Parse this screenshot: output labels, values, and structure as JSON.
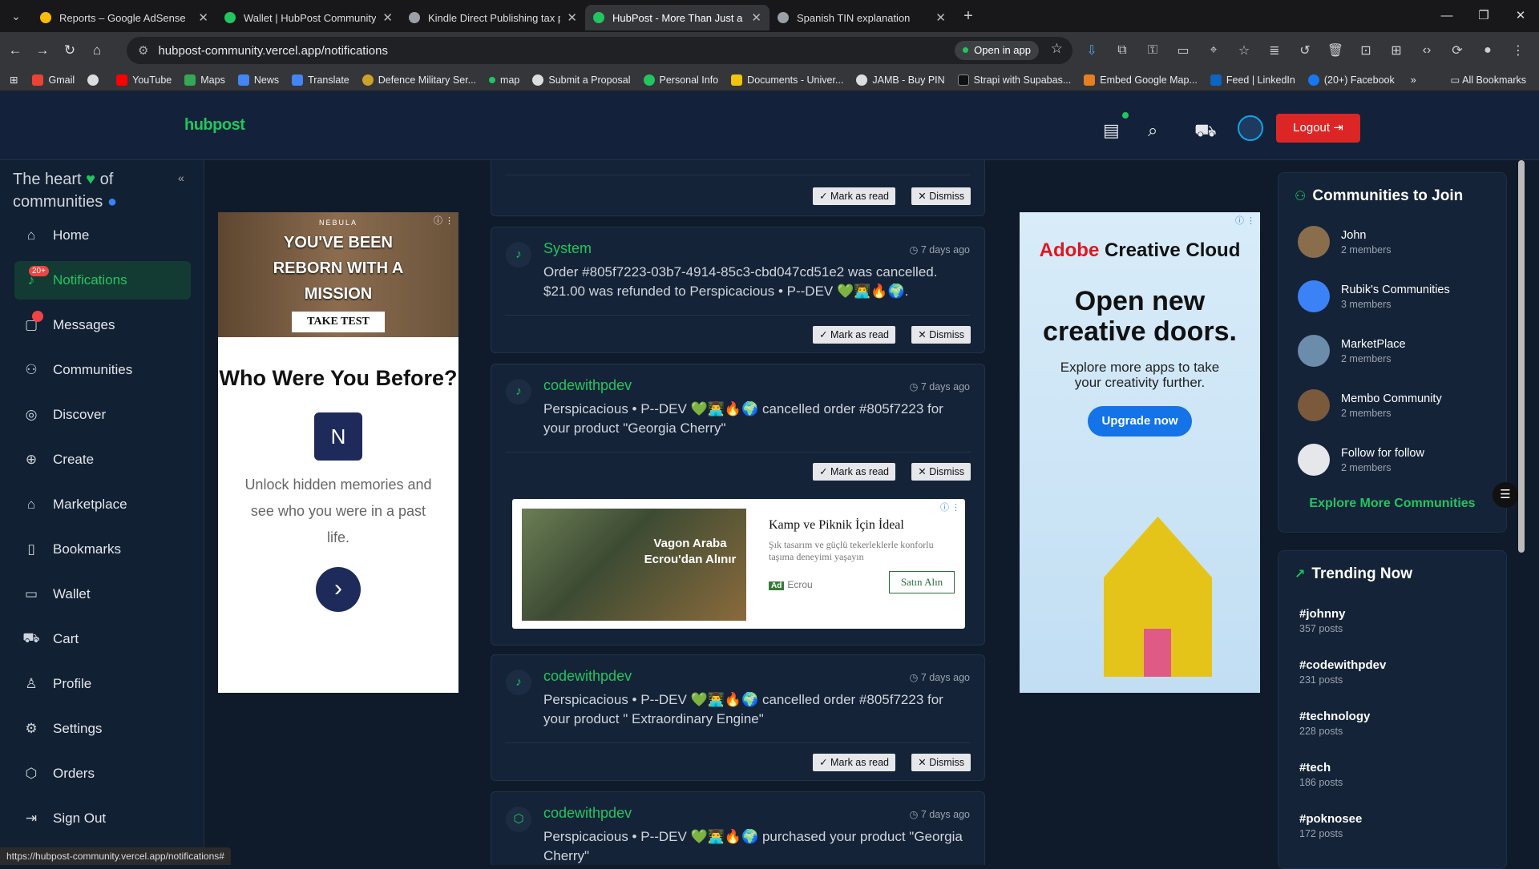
{
  "browser": {
    "tabs": [
      {
        "title": "Reports – Google AdSense",
        "color": "#fbbc04"
      },
      {
        "title": "Wallet | HubPost Community",
        "color": "#22c55e"
      },
      {
        "title": "Kindle Direct Publishing tax pro",
        "color": "#9aa0a6"
      },
      {
        "title": "HubPost - More Than Just a Co",
        "color": "#22c55e"
      },
      {
        "title": "Spanish TIN explanation",
        "color": "#9aa0a6"
      }
    ],
    "url": "hubpost-community.vercel.app/notifications",
    "open_in_app": "Open in app",
    "bookmarks": [
      "Gmail",
      "YouTube",
      "Maps",
      "News",
      "Translate",
      "Defence Military Ser...",
      "map",
      "Submit a Proposal",
      "Personal Info",
      "Documents - Univer...",
      "JAMB - Buy PIN",
      "Strapi with Supabas...",
      "Embed Google Map...",
      "Feed | LinkedIn",
      "(20+) Facebook"
    ],
    "all_bookmarks": "All Bookmarks",
    "status_url": "https://hubpost-community.vercel.app/notifications#"
  },
  "header": {
    "logo": "hubpost",
    "logout": "Logout"
  },
  "sidebar": {
    "tagline_1": "The heart",
    "tagline_2": "of",
    "tagline_3": "communities",
    "items": [
      {
        "label": "Home",
        "icon": "home-icon",
        "glyph": "⌂"
      },
      {
        "label": "Notifications",
        "icon": "bell-icon",
        "glyph": "♪",
        "badge": "20+"
      },
      {
        "label": "Messages",
        "icon": "message-icon",
        "glyph": "▢"
      },
      {
        "label": "Communities",
        "icon": "users-icon",
        "glyph": "⚇"
      },
      {
        "label": "Discover",
        "icon": "compass-icon",
        "glyph": "◎"
      },
      {
        "label": "Create",
        "icon": "plus-circle-icon",
        "glyph": "⊕"
      },
      {
        "label": "Marketplace",
        "icon": "store-icon",
        "glyph": "⌂"
      },
      {
        "label": "Bookmarks",
        "icon": "bookmark-icon",
        "glyph": "▯"
      },
      {
        "label": "Wallet",
        "icon": "wallet-icon",
        "glyph": "▭"
      },
      {
        "label": "Cart",
        "icon": "cart-icon",
        "glyph": "⛟"
      },
      {
        "label": "Profile",
        "icon": "user-icon",
        "glyph": "♙"
      },
      {
        "label": "Settings",
        "icon": "gear-icon",
        "glyph": "⚙"
      },
      {
        "label": "Orders",
        "icon": "package-icon",
        "glyph": "⬡"
      },
      {
        "label": "Sign Out",
        "icon": "sign-out-icon",
        "glyph": "⇥"
      }
    ]
  },
  "ad_left": {
    "brand": "NEBULA",
    "headline": "YOU'VE BEEN REBORN WITH A MISSION",
    "cta_top": "TAKE TEST",
    "title": "Who Were You Before?",
    "body": "Unlock hidden memories and see who you were in a past life."
  },
  "ad_right": {
    "brand_a": "Adobe",
    "brand_b": " Creative Cloud",
    "title": "Open new creative doors.",
    "body": "Explore more apps to take your creativity further.",
    "cta": "Upgrade now"
  },
  "feed": {
    "mark_read": "✓ Mark as read",
    "dismiss": "✕ Dismiss",
    "notifications": [
      {
        "who": "System",
        "time": "7 days ago",
        "msg": "Order #805f7223-03b7-4914-85c3-cbd047cd51e2 was cancelled. $21.00 was refunded to Perspicacious • P--DEV 💚👨‍💻🔥🌍."
      },
      {
        "who": "codewithpdev",
        "time": "7 days ago",
        "msg": "Perspicacious • P--DEV 💚👨‍💻🔥🌍 cancelled order #805f7223 for your product \"Georgia Cherry\""
      },
      {
        "who": "codewithpdev",
        "time": "7 days ago",
        "msg": "Perspicacious • P--DEV 💚👨‍💻🔥🌍 cancelled order #805f7223 for your product \" Extraordinary Engine\""
      },
      {
        "who": "codewithpdev",
        "time": "7 days ago",
        "msg": "Perspicacious • P--DEV 💚👨‍💻🔥🌍 purchased your product \"Georgia Cherry\""
      }
    ],
    "inline_ad": {
      "image_text": "Vagon Araba Ecrou'dan Alınır",
      "title": "Kamp ve Piknik İçin İdeal",
      "desc": "Şık tasarım ve güçlü tekerleklerle konforlu taşıma deneyimi yaşayın",
      "advertiser": "Ecrou",
      "ad_label": "Ad",
      "cta": "Satın Alın"
    }
  },
  "communities": {
    "title": "Communities to Join",
    "items": [
      {
        "name": "John",
        "members": "2 members",
        "color": "#8a6e4b"
      },
      {
        "name": "Rubik's Communities",
        "members": "3 members",
        "color": "#3b82f6"
      },
      {
        "name": "MarketPlace",
        "members": "2 members",
        "color": "#6b8caa"
      },
      {
        "name": "Membo Community",
        "members": "2 members",
        "color": "#7a5a3a"
      },
      {
        "name": "Follow for follow",
        "members": "2 members",
        "color": "#e5e7eb"
      }
    ],
    "explore": "Explore More Communities"
  },
  "trending": {
    "title": "Trending Now",
    "items": [
      {
        "tag": "#johnny",
        "posts": "357 posts"
      },
      {
        "tag": "#codewithpdev",
        "posts": "231 posts"
      },
      {
        "tag": "#technology",
        "posts": "228 posts"
      },
      {
        "tag": "#tech",
        "posts": "186 posts"
      },
      {
        "tag": "#poknosee",
        "posts": "172 posts"
      }
    ]
  }
}
